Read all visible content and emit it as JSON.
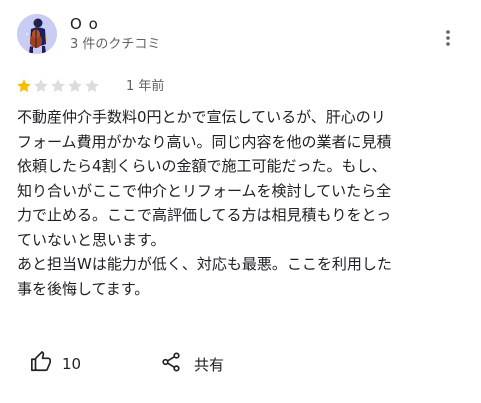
{
  "reviewer": {
    "name": "O o",
    "review_count": "3 件のクチコミ",
    "avatar_bg": "#c9cdf3"
  },
  "review": {
    "rating": 1,
    "max_rating": 5,
    "star_filled_color": "#fbbc04",
    "star_empty_color": "#dadce0",
    "date": "1 年前",
    "text": "不動産仲介手数料0円とかで宣伝しているが、肝心のリ\nフォーム費用がかなり高い。同じ内容を他の業者に見積\n依頼したら4割くらいの金額で施工可能だった。もし、\n知り合いがここで仲介とリフォームを検討していたら全\n力で止める。ここで高評価してる方は相見積もりをとっ\nていないと思います。\nあと担当Wは能力が低く、対応も最悪。ここを利用した\n事を後悔してます。"
  },
  "actions": {
    "like_count": "10",
    "share_label": "共有",
    "like_icon": "thumb-up-icon",
    "share_icon": "share-icon",
    "more_icon": "more-vert-icon"
  }
}
